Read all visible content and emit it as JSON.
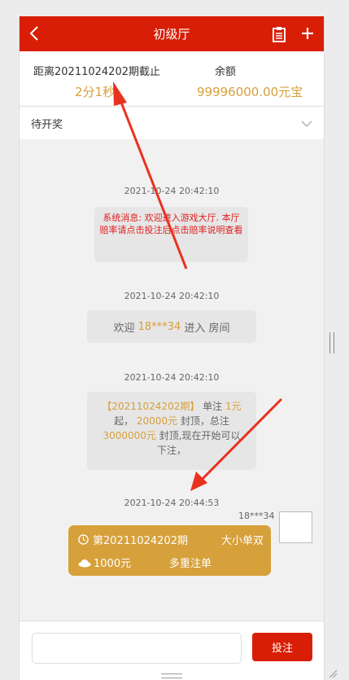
{
  "header": {
    "title": "初级厅",
    "back_icon": "chevron-left-icon",
    "records_icon": "clipboard-icon",
    "add_icon": "plus-icon"
  },
  "info": {
    "deadline_label": "距离20211024202期截止",
    "countdown": "2分1秒",
    "balance_label": "余额",
    "balance_value": "99996000.00元宝"
  },
  "status": {
    "label": "待开奖",
    "icon": "chevron-down-icon"
  },
  "messages": {
    "t1": "2021-10-24 20:42:10",
    "system_text": "系统消息: 欢迎进入游戏大厅. 本厅赔率请点击投注后点击赔率说明查看",
    "t2": "2021-10-24 20:42:10",
    "welcome_pre": "欢迎",
    "welcome_user": "18***34",
    "welcome_post": "进入 房间",
    "t3": "2021-10-24 20:42:10",
    "rules": {
      "period": "【20211024202期】",
      "p1": " 单注 ",
      "min": "1元",
      "p2": " 起， ",
      "max": "20000元",
      "p3": " 封顶，总注 ",
      "total": "3000000元",
      "p4": " 封顶,现在开始可以下注，"
    },
    "t4": "2021-10-24 20:44:53",
    "bet": {
      "user": "18***34",
      "period": "第20211024202期",
      "type": "大小单双",
      "amount": "1000元",
      "mode": "多重注单"
    }
  },
  "footer": {
    "input_placeholder": "",
    "submit_label": "投注"
  },
  "colors": {
    "brand_red": "#d81e06",
    "gold": "#d6a03a",
    "annotation_arrow": "#e8321f"
  }
}
